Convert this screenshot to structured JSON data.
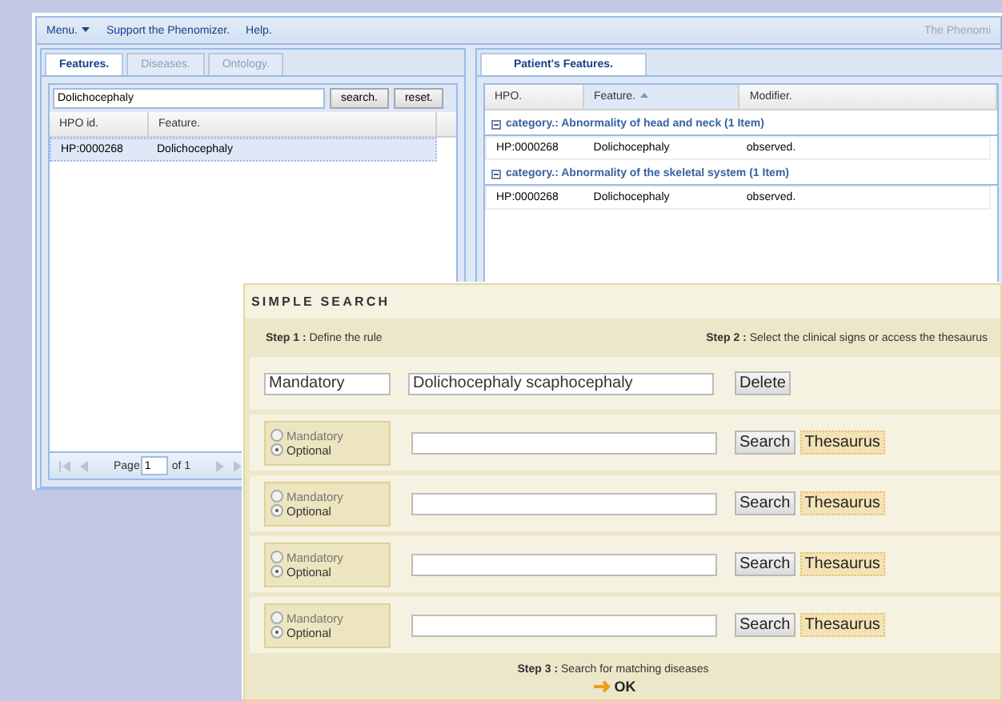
{
  "app": {
    "menu": [
      {
        "label": "Menu.",
        "has_caret": true
      },
      {
        "label": "Support the Phenomizer.",
        "has_caret": false
      },
      {
        "label": "Help.",
        "has_caret": false
      }
    ],
    "brand": "The Phenomi",
    "left_panel": {
      "tabs": [
        {
          "label": "Features.",
          "selected": true
        },
        {
          "label": "Diseases.",
          "selected": false
        },
        {
          "label": "Ontology.",
          "selected": false
        }
      ],
      "search": {
        "value": "Dolichocephaly",
        "buttons": [
          "search.",
          "reset."
        ]
      },
      "columns": [
        "HPO id.",
        "Feature."
      ],
      "rows": [
        {
          "cells": [
            "HP:0000268",
            "Dolichocephaly"
          ],
          "selected": true
        }
      ],
      "pager": {
        "label": "Page",
        "value": "1",
        "total": "of 1"
      }
    },
    "right_panel": {
      "tabs": [
        {
          "label": "Patient's Features.",
          "selected": true
        }
      ],
      "columns": [
        {
          "label": "HPO.",
          "sorted": false
        },
        {
          "label": "Feature.",
          "sorted": true
        },
        {
          "label": "Modifier.",
          "sorted": false
        }
      ],
      "groups": [
        {
          "title": "category.: Abnormality of head and neck (1 Item)",
          "expanded": true,
          "rows": [
            [
              "HP:0000268",
              "Dolichocephaly",
              "observed."
            ]
          ]
        },
        {
          "title": "category.: Abnormality of the skeletal system (1 Item)",
          "expanded": true,
          "rows": [
            [
              "HP:0000268",
              "Dolichocephaly",
              "observed."
            ]
          ]
        }
      ]
    }
  },
  "simple_search": {
    "title": "SIMPLE SEARCH",
    "step1": {
      "label": "Step 1 :",
      "text": "Define the rule"
    },
    "step2": {
      "label": "Step 2 :",
      "text": "Select the clinical signs or access the thesaurus"
    },
    "rules": [
      {
        "kind": "defined",
        "mode": "Mandatory",
        "term": "Dolichocephaly scaphocephaly",
        "button": "Delete"
      },
      {
        "kind": "empty",
        "options": [
          {
            "label": "Mandatory",
            "selected": false
          },
          {
            "label": "Optional",
            "selected": true
          }
        ],
        "search": "Search",
        "thesaurus": "Thesaurus"
      },
      {
        "kind": "empty",
        "options": [
          {
            "label": "Mandatory",
            "selected": false
          },
          {
            "label": "Optional",
            "selected": true
          }
        ],
        "search": "Search",
        "thesaurus": "Thesaurus"
      },
      {
        "kind": "empty",
        "options": [
          {
            "label": "Mandatory",
            "selected": false
          },
          {
            "label": "Optional",
            "selected": true
          }
        ],
        "search": "Search",
        "thesaurus": "Thesaurus"
      },
      {
        "kind": "empty",
        "options": [
          {
            "label": "Mandatory",
            "selected": false
          },
          {
            "label": "Optional",
            "selected": true
          }
        ],
        "search": "Search",
        "thesaurus": "Thesaurus"
      }
    ],
    "step3": {
      "label": "Step 3 :",
      "text": "Search for matching diseases"
    },
    "ok": "OK"
  }
}
